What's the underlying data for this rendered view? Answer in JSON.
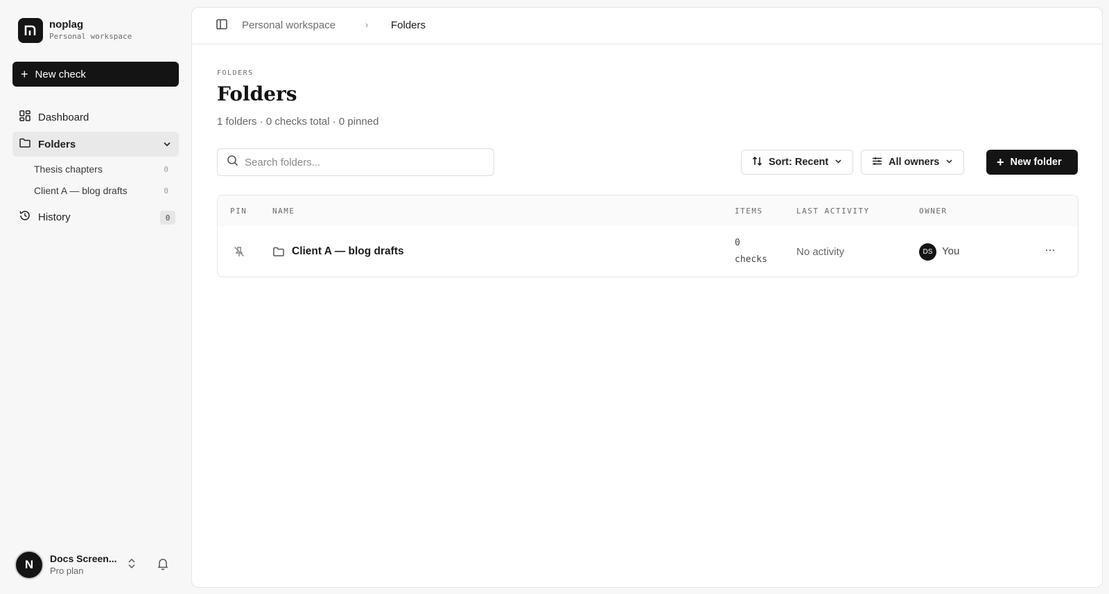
{
  "brand": {
    "name": "noplag",
    "subtitle": "Personal workspace"
  },
  "sidebar": {
    "new_check_label": "New check",
    "nav": {
      "dashboard": "Dashboard",
      "folders": "Folders",
      "history": "History",
      "history_count": "0"
    },
    "folder_items": [
      {
        "label": "Thesis chapters",
        "count": "0"
      },
      {
        "label": "Client A — blog drafts",
        "count": "0"
      }
    ],
    "user": {
      "initial": "N",
      "name": "Docs Screen...",
      "plan": "Pro plan"
    }
  },
  "breadcrumb": {
    "root": "Personal workspace",
    "separator": "›",
    "current": "Folders"
  },
  "page": {
    "eyebrow": "FOLDERS",
    "title": "Folders",
    "summary": "1 folders · 0 checks total · 0 pinned"
  },
  "toolbar": {
    "search_placeholder": "Search folders...",
    "sort_label": "Sort: Recent",
    "owners_label": "All owners",
    "new_folder_label": "New folder"
  },
  "table": {
    "columns": {
      "pin": "PIN",
      "name": "NAME",
      "items": "ITEMS",
      "last_activity": "LAST ACTIVITY",
      "owner": "OWNER"
    },
    "rows": [
      {
        "name": "Client A — blog drafts",
        "items_count": "0",
        "items_unit": "checks",
        "last_activity": "No activity",
        "owner_initials": "DS",
        "owner": "You",
        "more": "···"
      }
    ]
  },
  "icons": [
    "logo-icon",
    "plus-icon",
    "dashboard-icon",
    "folder-icon",
    "chevron-down-icon",
    "history-icon",
    "sidebar-toggle-icon",
    "search-icon",
    "sort-icon",
    "filter-icon",
    "pin-off-icon",
    "more-icon",
    "chevrons-updown-icon",
    "bell-icon"
  ],
  "colors": {
    "primary": "#141414",
    "background": "#f7f7f7",
    "panel": "#ffffff",
    "muted_text": "#6b6b6b"
  }
}
